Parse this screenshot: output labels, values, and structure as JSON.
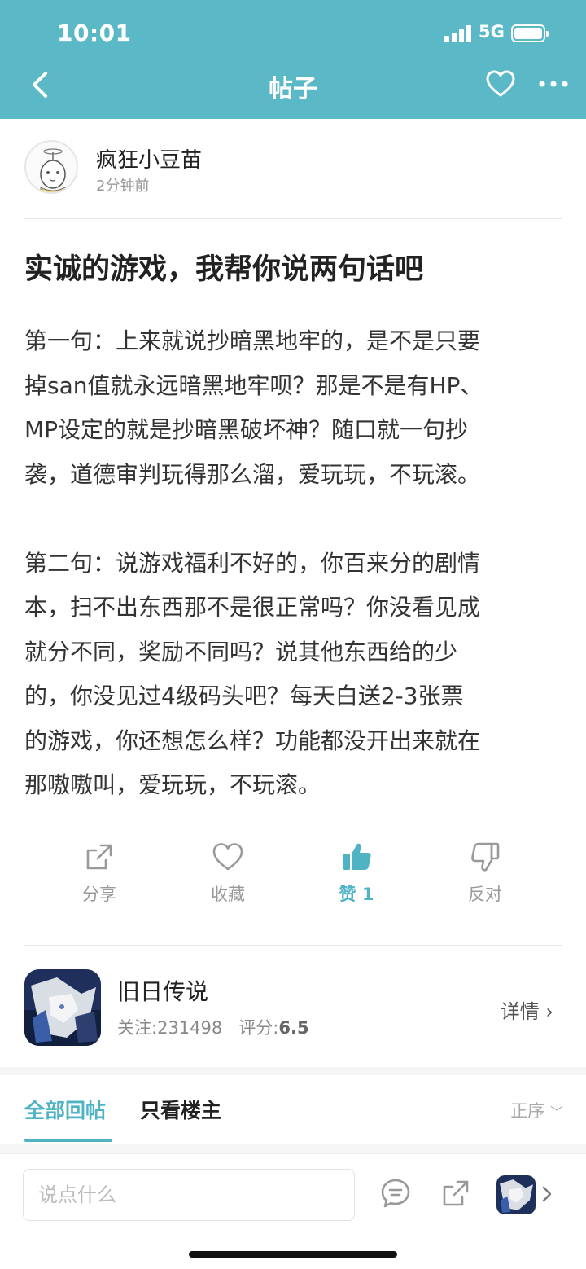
{
  "status_bar": {
    "time": "10:01",
    "network": "5G"
  },
  "nav": {
    "title": "帖子"
  },
  "author": {
    "name": "疯狂小豆苗",
    "time": "2分钟前"
  },
  "post": {
    "title": "实诚的游戏，我帮你说两句话吧",
    "body_lines": [
      "第一句：上来就说抄暗黑地牢的，是不是只要",
      "掉san值就永远暗黑地牢呗？那是不是有HP、",
      "MP设定的就是抄暗黑破坏神？随口就一句抄",
      "袭，道德审判玩得那么溜，爱玩玩，不玩滚。",
      "",
      "第二句：说游戏福利不好的，你百来分的剧情",
      "本，扫不出东西那不是很正常吗？你没看见成",
      "就分不同，奖励不同吗？说其他东西给的少",
      "的，你没见过4级码头吧？每天白送2-3张票",
      "的游戏，你还想怎么样？功能都没开出来就在",
      "那嗷嗷叫，爱玩玩，不玩滚。"
    ]
  },
  "actions": {
    "share": "分享",
    "favorite": "收藏",
    "like": "赞",
    "like_count": "1",
    "dislike": "反对"
  },
  "game": {
    "name": "旧日传说",
    "followers_label": "关注:",
    "followers": "231498",
    "rating_label": "评分:",
    "rating": "6.5",
    "detail_label": "详情"
  },
  "reply_tabs": {
    "all": "全部回帖",
    "owner_only": "只看楼主",
    "sort": "正序"
  },
  "bottom_bar": {
    "comment_placeholder": "说点什么"
  },
  "colors": {
    "accent": "#5bb8c7",
    "liked": "#4fb3c4"
  }
}
